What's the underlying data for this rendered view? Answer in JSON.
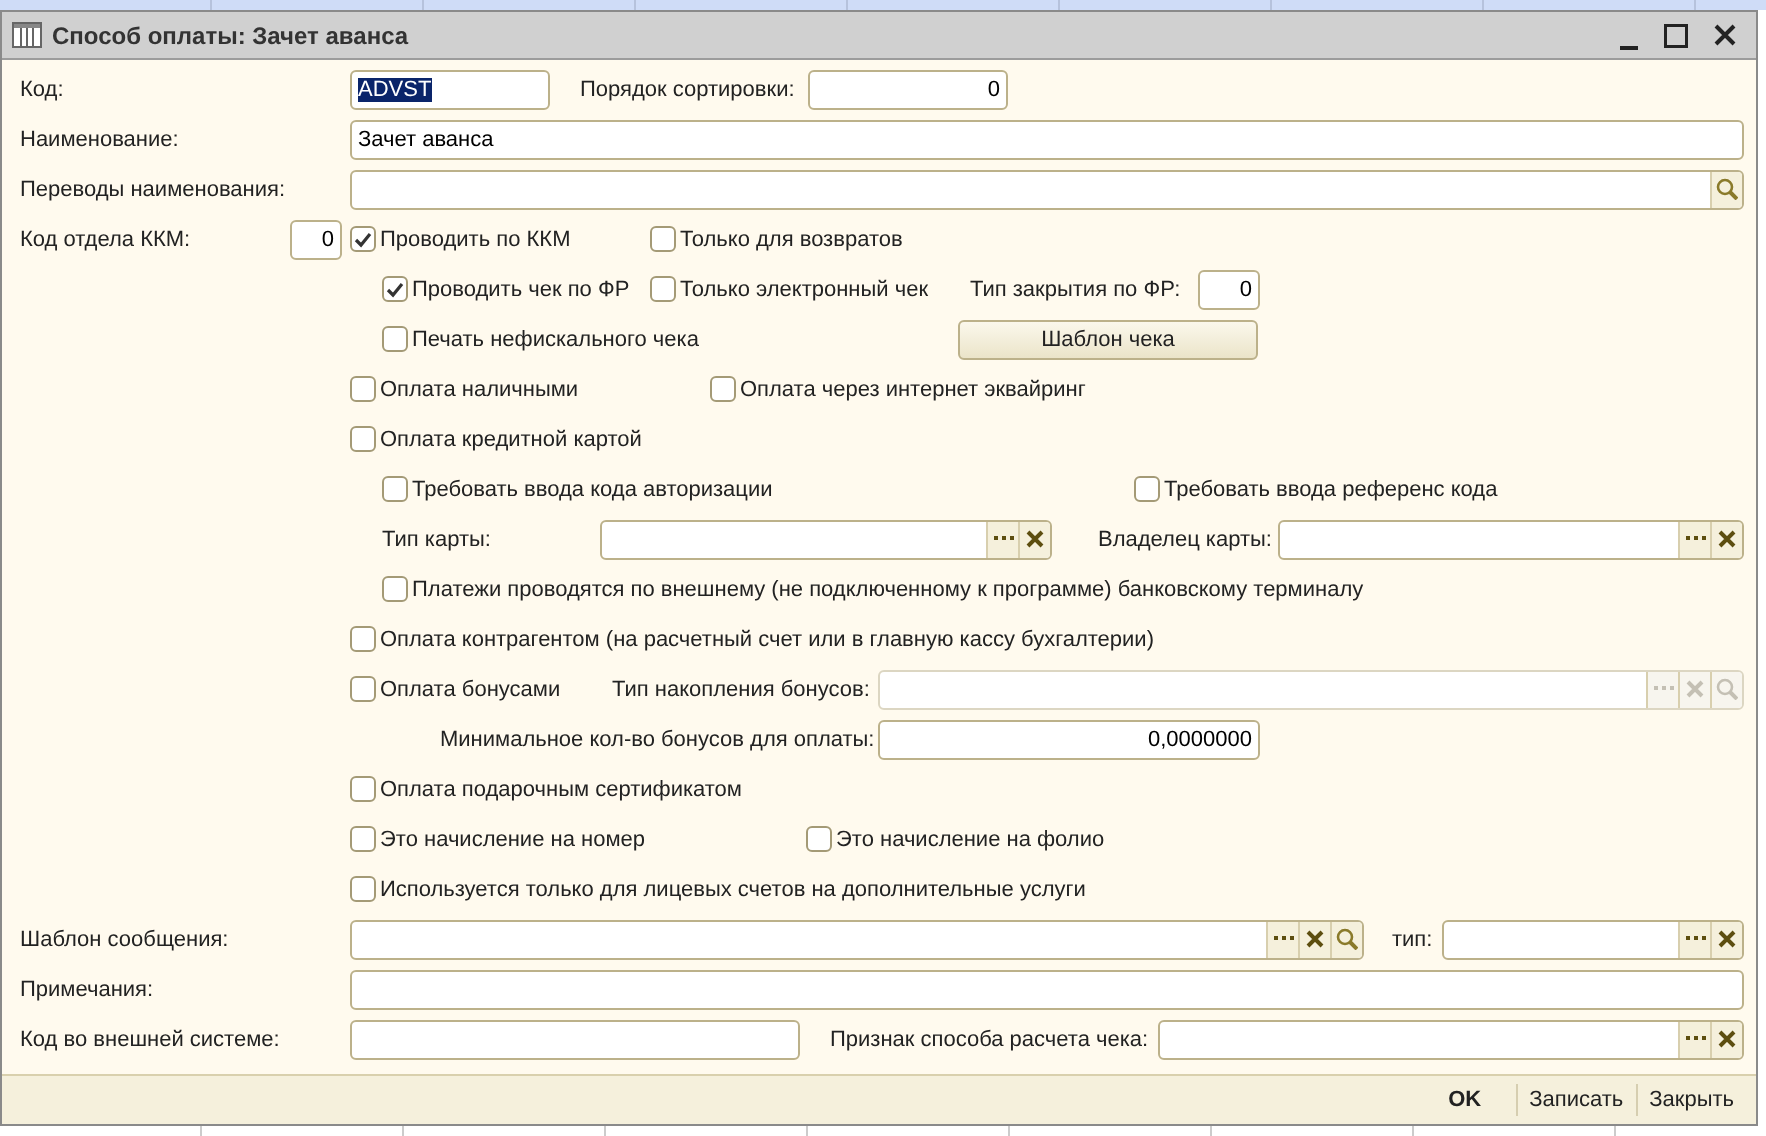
{
  "window": {
    "title": "Способ оплаты: Зачет аванса"
  },
  "rows": [
    {
      "items": [
        {
          "kind": "label",
          "text": "Код:"
        },
        {
          "kind": "field",
          "value": "ADVST",
          "highlighted": true,
          "disabled": false
        },
        {
          "kind": "label",
          "text": "Порядок сортировки:"
        },
        {
          "kind": "field",
          "value": "0",
          "highlighted": false,
          "disabled": false
        }
      ]
    },
    {
      "items": [
        {
          "kind": "label",
          "text": "Наименование:"
        },
        {
          "kind": "field",
          "value": "Зачет аванса",
          "highlighted": false,
          "disabled": false
        }
      ]
    },
    {
      "items": [
        {
          "kind": "label",
          "text": "Переводы наименования:"
        },
        {
          "kind": "field",
          "highlighted": false,
          "disabled": false,
          "actions": [
            {
              "kind": "search"
            }
          ]
        }
      ]
    },
    {
      "items": [
        {
          "kind": "label",
          "text": "Код отдела ККМ:"
        },
        {
          "kind": "field",
          "value": "0",
          "highlighted": false,
          "disabled": false
        },
        {
          "kind": "checkbox",
          "label": "Проводить по ККМ",
          "checked": true
        },
        {
          "kind": "checkbox",
          "label": "Только для возвратов",
          "checked": false
        }
      ]
    },
    {
      "items": [
        {
          "kind": "checkbox",
          "label": "Проводить чек по ФР",
          "checked": true
        },
        {
          "kind": "checkbox",
          "label": "Только электронный чек",
          "checked": false
        },
        {
          "kind": "label",
          "text": "Тип закрытия по ФР:"
        },
        {
          "kind": "field",
          "value": "0",
          "highlighted": false,
          "disabled": false
        }
      ]
    },
    {
      "items": [
        {
          "kind": "checkbox",
          "label": "Печать нефискального чека",
          "checked": false
        },
        {
          "kind": "button",
          "label": "Шаблон чека"
        }
      ]
    },
    {
      "items": [
        {
          "kind": "checkbox",
          "label": "Оплата наличными",
          "checked": false
        },
        {
          "kind": "checkbox",
          "label": "Оплата через интернет эквайринг",
          "checked": false
        }
      ]
    },
    {
      "items": [
        {
          "kind": "checkbox",
          "label": "Оплата кредитной картой",
          "checked": false
        }
      ]
    },
    {
      "items": [
        {
          "kind": "checkbox",
          "label": "Требовать ввода кода авторизации",
          "checked": false
        },
        {
          "kind": "checkbox",
          "label": "Требовать ввода референс кода",
          "checked": false
        }
      ]
    },
    {
      "items": [
        {
          "kind": "label",
          "text": "Тип карты:"
        },
        {
          "kind": "field",
          "highlighted": false,
          "disabled": false,
          "actions": [
            {
              "kind": "choose"
            },
            {
              "kind": "clear"
            }
          ]
        },
        {
          "kind": "label",
          "text": "Владелец карты:"
        },
        {
          "kind": "field",
          "highlighted": false,
          "disabled": false,
          "actions": [
            {
              "kind": "choose"
            },
            {
              "kind": "clear"
            }
          ]
        }
      ]
    },
    {
      "items": [
        {
          "kind": "checkbox",
          "label": "Платежи проводятся по внешнему (не подключенному к программе) банковскому терминалу",
          "checked": false
        }
      ]
    },
    {
      "items": [
        {
          "kind": "checkbox",
          "label": "Оплата контрагентом (на расчетный счет или в главную кассу бухгалтерии)",
          "checked": false
        }
      ]
    },
    {
      "items": [
        {
          "kind": "checkbox",
          "label": "Оплата бонусами",
          "checked": false
        },
        {
          "kind": "label",
          "text": "Тип накопления бонусов:"
        },
        {
          "kind": "field",
          "highlighted": false,
          "disabled": true,
          "actions": [
            {
              "kind": "choose"
            },
            {
              "kind": "clear"
            },
            {
              "kind": "search"
            }
          ]
        }
      ]
    },
    {
      "items": [
        {
          "kind": "label",
          "text": "Минимальное кол-во бонусов для оплаты:"
        },
        {
          "kind": "field",
          "value": "0,0000000",
          "highlighted": false,
          "disabled": false
        }
      ]
    },
    {
      "items": [
        {
          "kind": "checkbox",
          "label": "Оплата подарочным сертификатом",
          "checked": false
        }
      ]
    },
    {
      "items": [
        {
          "kind": "checkbox",
          "label": "Это начисление на номер",
          "checked": false
        },
        {
          "kind": "checkbox",
          "label": "Это начисление на фолио",
          "checked": false
        }
      ]
    },
    {
      "items": [
        {
          "kind": "checkbox",
          "label": "Используется только для лицевых счетов на дополнительные услуги",
          "checked": false
        }
      ]
    },
    {
      "items": [
        {
          "kind": "label",
          "text": "Шаблон сообщения:"
        },
        {
          "kind": "field",
          "highlighted": false,
          "disabled": false,
          "actions": [
            {
              "kind": "choose"
            },
            {
              "kind": "clear"
            },
            {
              "kind": "search"
            }
          ]
        },
        {
          "kind": "label",
          "text": "тип:"
        },
        {
          "kind": "field",
          "highlighted": false,
          "disabled": false,
          "actions": [
            {
              "kind": "choose"
            },
            {
              "kind": "clear"
            }
          ]
        }
      ]
    },
    {
      "items": [
        {
          "kind": "label",
          "text": "Примечания:"
        },
        {
          "kind": "field",
          "highlighted": false,
          "disabled": false
        }
      ]
    },
    {
      "items": [
        {
          "kind": "label",
          "text": "Код во внешней системе:"
        },
        {
          "kind": "field",
          "highlighted": false,
          "disabled": false
        },
        {
          "kind": "label",
          "text": "Признак способа расчета чека:"
        },
        {
          "kind": "field",
          "highlighted": false,
          "disabled": false,
          "actions": [
            {
              "kind": "choose"
            },
            {
              "kind": "clear"
            }
          ]
        }
      ]
    }
  ],
  "buttons": [
    {
      "label": "OK",
      "default": true
    },
    {
      "label": "Записать",
      "default": false
    },
    {
      "label": "Закрыть",
      "default": false
    }
  ]
}
